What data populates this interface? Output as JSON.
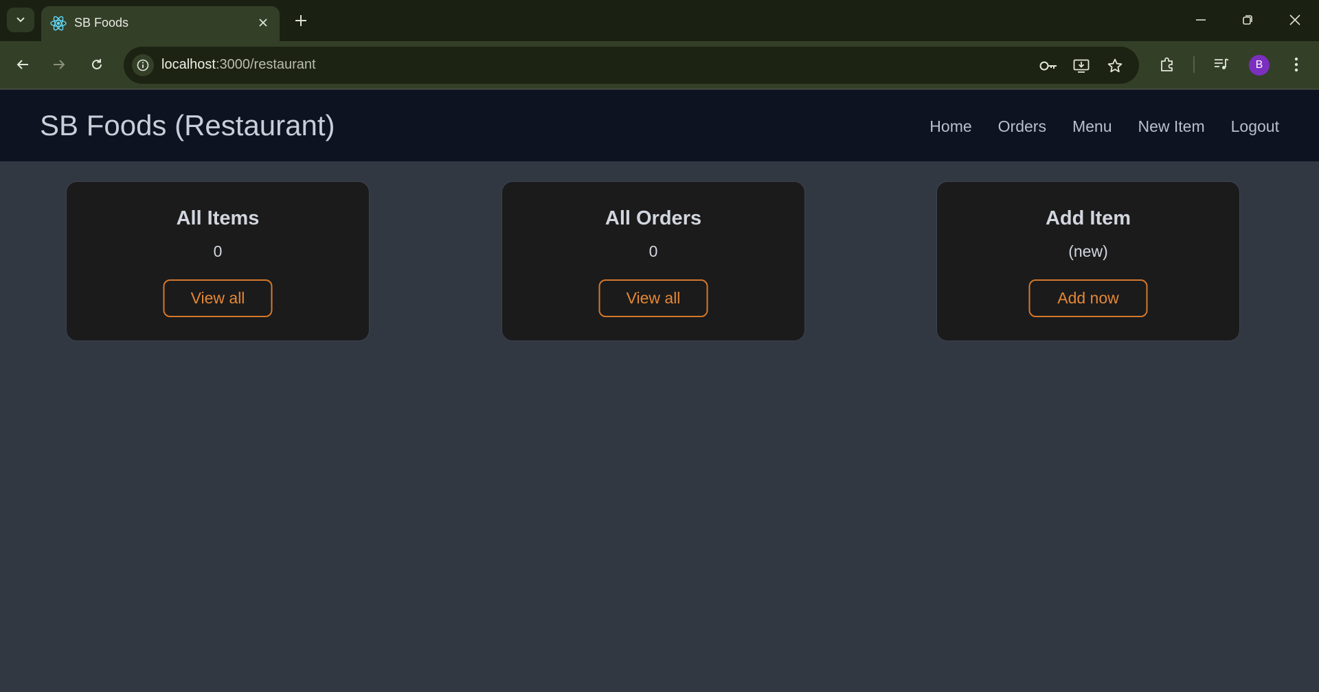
{
  "browser": {
    "tab_title": "SB Foods",
    "url_host": "localhost",
    "url_path": ":3000/restaurant",
    "profile_initial": "B",
    "colors": {
      "frame": "#1a2012",
      "toolbar": "#343f28",
      "avatar": "#7b2fbf"
    }
  },
  "app": {
    "brand": "SB Foods (Restaurant)",
    "nav": [
      {
        "label": "Home"
      },
      {
        "label": "Orders"
      },
      {
        "label": "Menu"
      },
      {
        "label": "New Item"
      },
      {
        "label": "Logout"
      }
    ]
  },
  "cards": [
    {
      "title": "All Items",
      "value": "0",
      "button": "View all"
    },
    {
      "title": "All Orders",
      "value": "0",
      "button": "View all"
    },
    {
      "title": "Add Item",
      "value": "(new)",
      "button": "Add now"
    }
  ],
  "theme": {
    "page_bg": "#313842",
    "navbar_bg": "#0d1320",
    "card_bg": "#1b1b1c",
    "accent": "#e58734"
  }
}
